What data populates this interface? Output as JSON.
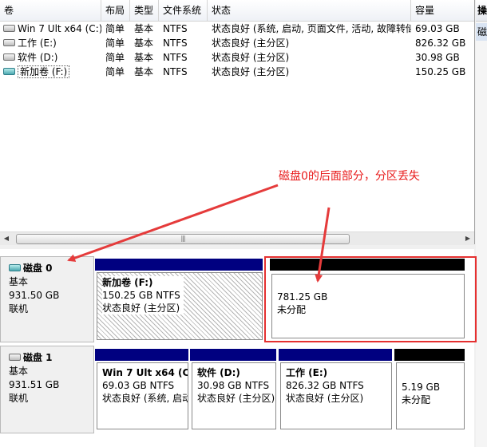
{
  "columns": [
    "卷",
    "布局",
    "类型",
    "文件系统",
    "状态",
    "容量"
  ],
  "action_header": "操",
  "action_item": "磁",
  "volumes": [
    {
      "name": "Win 7 Ult x64 (C:)",
      "layout": "简单",
      "type": "基本",
      "fs": "NTFS",
      "status": "状态良好 (系统, 启动, 页面文件, 活动, 故障转储, 主分区)",
      "capacity": "69.03 GB",
      "icon": "drive-icon"
    },
    {
      "name": "工作 (E:)",
      "layout": "简单",
      "type": "基本",
      "fs": "NTFS",
      "status": "状态良好 (主分区)",
      "capacity": "826.32 GB",
      "icon": "drive-icon"
    },
    {
      "name": "软件 (D:)",
      "layout": "简单",
      "type": "基本",
      "fs": "NTFS",
      "status": "状态良好 (主分区)",
      "capacity": "30.98 GB",
      "icon": "drive-icon"
    },
    {
      "name": "新加卷 (F:)",
      "layout": "简单",
      "type": "基本",
      "fs": "NTFS",
      "status": "状态良好 (主分区)",
      "capacity": "150.25 GB",
      "icon": "drive-icon-green"
    }
  ],
  "disks": [
    {
      "name": "磁盘 0",
      "kind": "基本",
      "size": "931.50 GB",
      "state": "联机",
      "icon": "disk-icon",
      "partitions": [
        {
          "name": "新加卷  (F:)",
          "size": "150.25 GB NTFS",
          "status": "状态良好 (主分区)",
          "color": "#000080"
        },
        {
          "name": "",
          "size": "781.25 GB",
          "status": "未分配",
          "color": "#000000"
        }
      ]
    },
    {
      "name": "磁盘 1",
      "kind": "基本",
      "size": "931.51 GB",
      "state": "联机",
      "icon": "disk-icon",
      "partitions": [
        {
          "name": "Win 7 Ult x64  (C",
          "size": "69.03 GB NTFS",
          "status": "状态良好 (系统, 启动",
          "color": "#000080"
        },
        {
          "name": "软件  (D:)",
          "size": "30.98 GB NTFS",
          "status": "状态良好 (主分区)",
          "color": "#000080"
        },
        {
          "name": "工作  (E:)",
          "size": "826.32 GB NTFS",
          "status": "状态良好 (主分区)",
          "color": "#000080"
        },
        {
          "name": "",
          "size": "5.19 GB",
          "status": "未分配",
          "color": "#000000"
        }
      ]
    }
  ],
  "annotation": {
    "text": "磁盘0的后面部分，分区丢失",
    "color": "#e81b1b"
  }
}
